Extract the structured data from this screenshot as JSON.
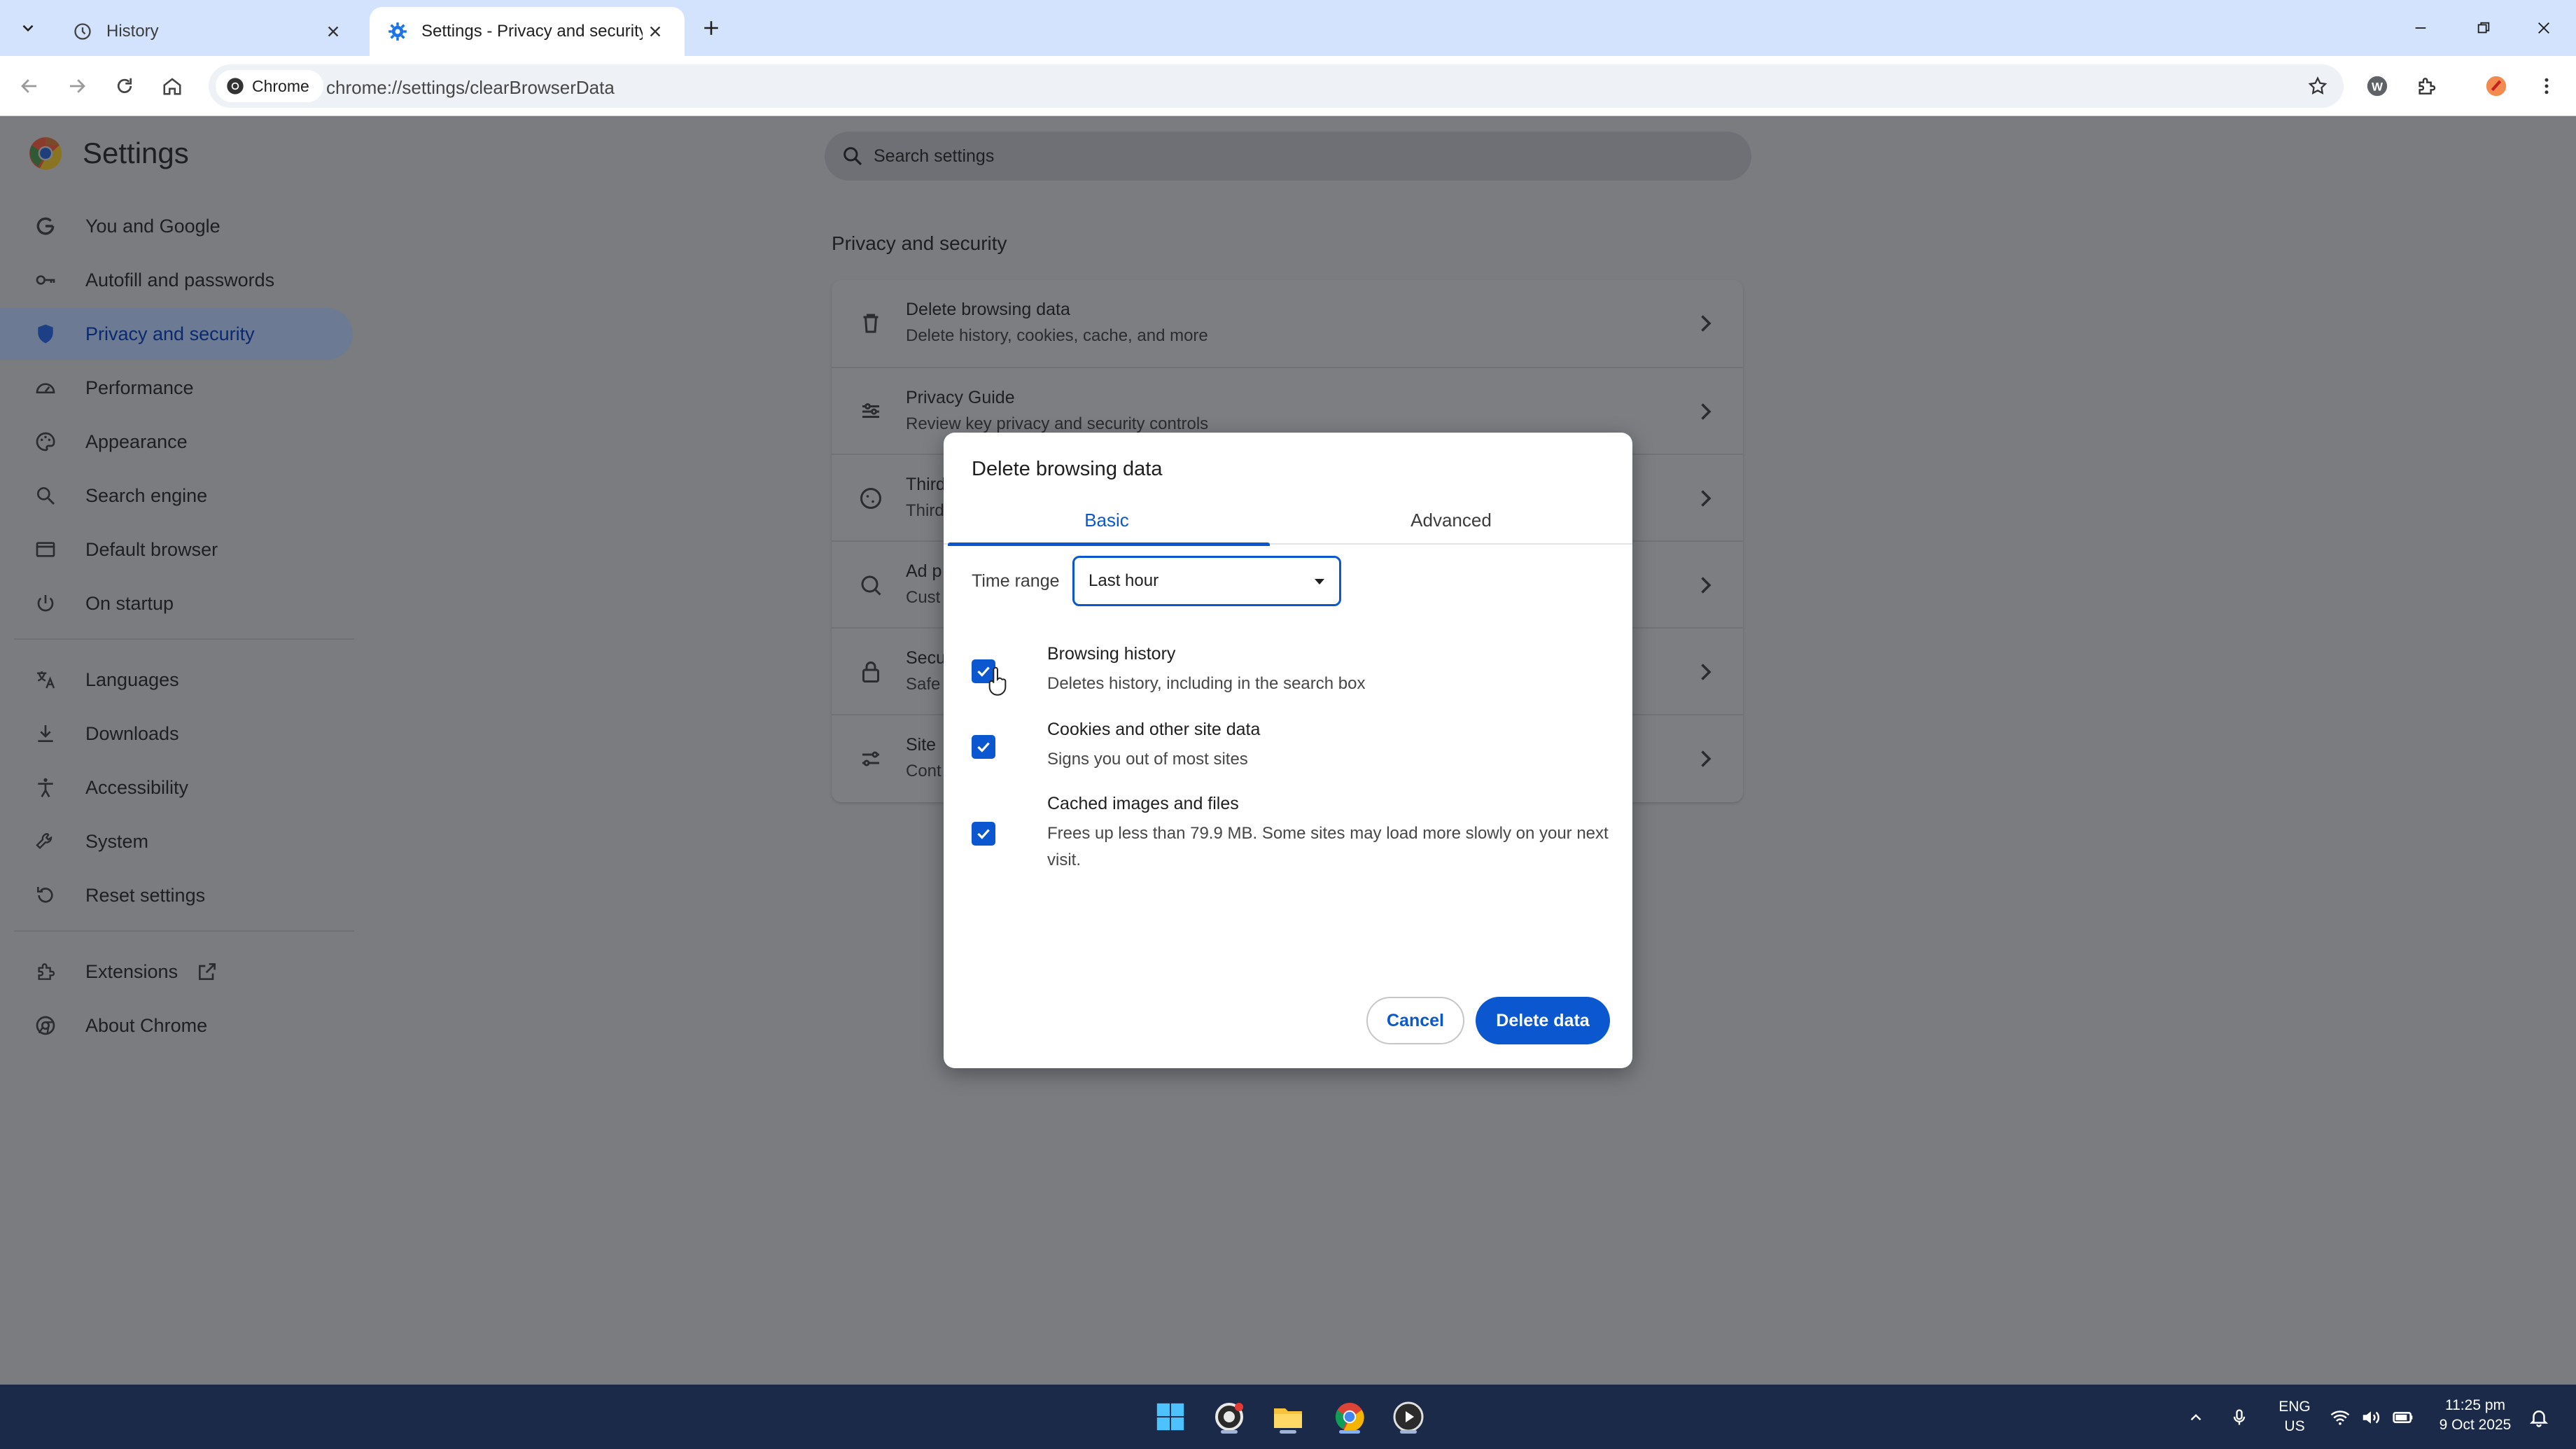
{
  "browser": {
    "tabs": [
      {
        "title": "History",
        "icon": "history-icon",
        "active": false
      },
      {
        "title": "Settings - Privacy and security",
        "icon": "gear-icon",
        "active": true
      }
    ],
    "omnibox": {
      "chip_label": "Chrome",
      "url": "chrome://settings/clearBrowserData"
    }
  },
  "settings": {
    "title": "Settings",
    "search_placeholder": "Search settings",
    "nav": [
      {
        "label": "You and Google",
        "icon": "google-icon"
      },
      {
        "label": "Autofill and passwords",
        "icon": "key-icon"
      },
      {
        "label": "Privacy and security",
        "icon": "shield-icon",
        "active": true
      },
      {
        "label": "Performance",
        "icon": "speedometer-icon"
      },
      {
        "label": "Appearance",
        "icon": "palette-icon"
      },
      {
        "label": "Search engine",
        "icon": "search-icon"
      },
      {
        "label": "Default browser",
        "icon": "browser-window-icon"
      },
      {
        "label": "On startup",
        "icon": "power-icon"
      },
      {
        "label": "Languages",
        "icon": "translate-icon"
      },
      {
        "label": "Downloads",
        "icon": "download-icon"
      },
      {
        "label": "Accessibility",
        "icon": "accessibility-icon"
      },
      {
        "label": "System",
        "icon": "wrench-icon"
      },
      {
        "label": "Reset settings",
        "icon": "reset-icon"
      },
      {
        "label": "Extensions",
        "icon": "puzzle-icon"
      },
      {
        "label": "About Chrome",
        "icon": "chrome-icon"
      }
    ],
    "section_title": "Privacy and security",
    "rows": [
      {
        "title": "Delete browsing data",
        "subtitle": "Delete history, cookies, cache, and more",
        "icon": "trash-icon"
      },
      {
        "title": "Privacy Guide",
        "subtitle": "Review key privacy and security controls",
        "icon": "sliders-icon"
      },
      {
        "title": "Third",
        "subtitle": "Third",
        "icon": "cookie-icon"
      },
      {
        "title": "Ad p",
        "subtitle": "Cust",
        "icon": "ad-privacy-icon"
      },
      {
        "title": "Secu",
        "subtitle": "Safe",
        "icon": "lock-icon"
      },
      {
        "title": "Site",
        "subtitle": "Cont",
        "icon": "site-settings-icon"
      }
    ]
  },
  "dialog": {
    "title": "Delete browsing data",
    "tabs": [
      "Basic",
      "Advanced"
    ],
    "active_tab": "Basic",
    "time_range_label": "Time range",
    "time_range_value": "Last hour",
    "options": [
      {
        "title": "Browsing history",
        "subtitle": "Deletes history, including in the search box",
        "checked": true
      },
      {
        "title": "Cookies and other site data",
        "subtitle": "Signs you out of most sites",
        "checked": true
      },
      {
        "title": "Cached images and files",
        "subtitle": "Frees up less than 79.9 MB. Some sites may load more slowly on your next visit.",
        "checked": true
      }
    ],
    "cancel_label": "Cancel",
    "delete_label": "Delete data"
  },
  "taskbar": {
    "language": "ENG",
    "region": "US",
    "time": "11:25 pm",
    "date": "9 Oct 2025"
  },
  "colors": {
    "accent": "#0b57d0",
    "tabstrip": "#d3e3fd",
    "taskbar": "#1c2a4a"
  }
}
